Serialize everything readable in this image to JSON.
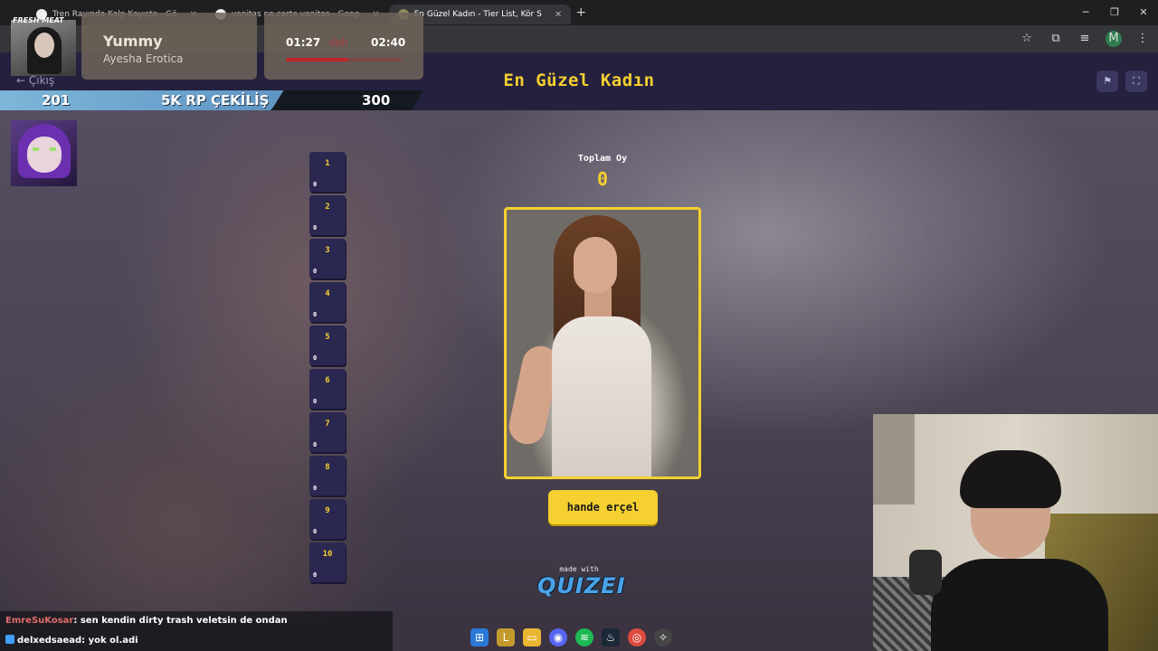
{
  "browser": {
    "tabs": [
      {
        "title": "Tren Rayında Kalp Kayışta - Gö",
        "active": false
      },
      {
        "title": "vanitas no carte vanitas - Goog",
        "active": false
      },
      {
        "title": "En Güzel Kadın - Tier List, Kör S",
        "active": true
      }
    ],
    "new_tab": "+",
    "profile_initial": "M"
  },
  "overlay": {
    "label": "FRESH MEAT",
    "song": "Yummy",
    "artist": "Ayesha Erotica",
    "elapsed": "01:27",
    "duration": "02:40",
    "progress": 0.54,
    "banner_left": "201",
    "banner_mid": "5K RP ÇEKİLİŞ",
    "banner_right": "300"
  },
  "header": {
    "back_label": "← Çıkış",
    "title": "En Güzel Kadın"
  },
  "ranks": [
    {
      "num": "1",
      "count": "0"
    },
    {
      "num": "2",
      "count": "0"
    },
    {
      "num": "3",
      "count": "0"
    },
    {
      "num": "4",
      "count": "0"
    },
    {
      "num": "5",
      "count": "0"
    },
    {
      "num": "6",
      "count": "0"
    },
    {
      "num": "7",
      "count": "0"
    },
    {
      "num": "8",
      "count": "0"
    },
    {
      "num": "9",
      "count": "0"
    },
    {
      "num": "10",
      "count": "0"
    }
  ],
  "vote": {
    "total_label": "Toplam Oy",
    "total_value": "0",
    "candidate_name": "hande erçel"
  },
  "footer": {
    "made_with": "made with",
    "brand": "QUIZEI"
  },
  "chat": [
    {
      "user": "EmreSuKosar",
      "message": ": sen kendin dirty trash veletsin de ondan"
    },
    {
      "user": "delxedsaead",
      "message": ": yok ol.adi"
    }
  ],
  "colors": {
    "accent": "#f5d030",
    "header_bg": "#24213f",
    "rank_bg": "#2a2750"
  }
}
